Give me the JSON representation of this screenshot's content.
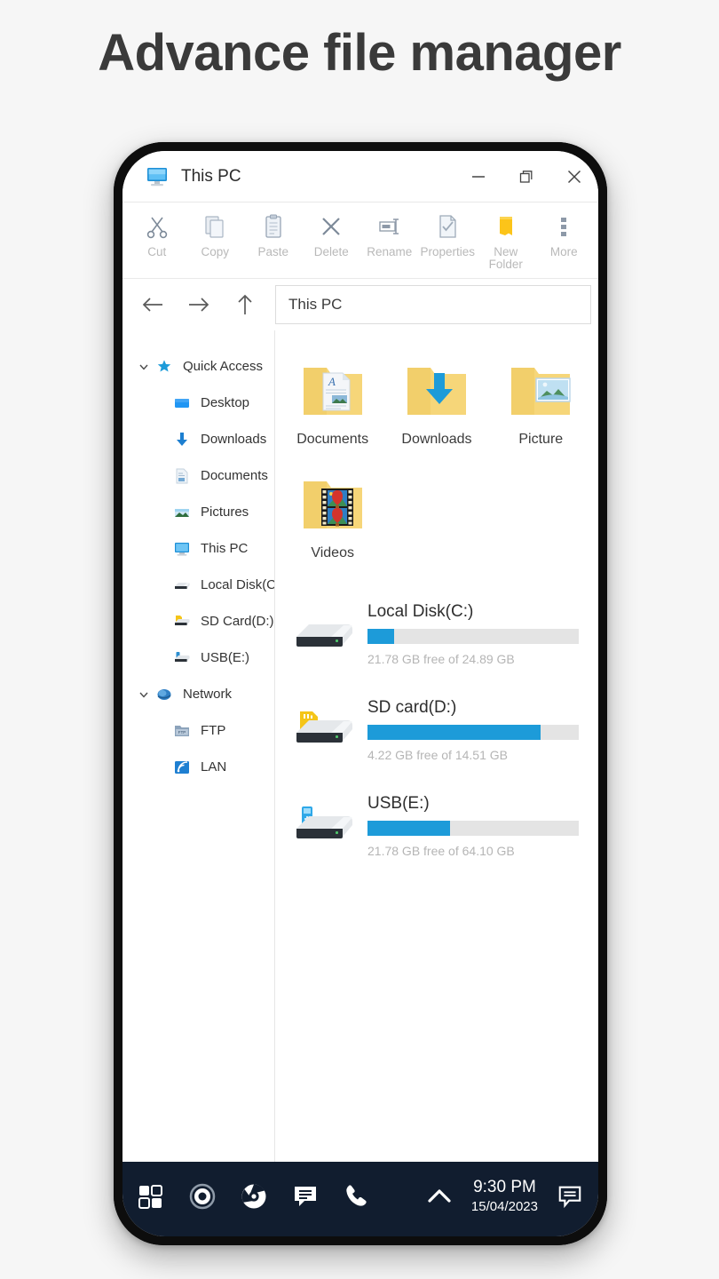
{
  "headline": "Advance file manager",
  "window": {
    "title": "This PC",
    "icon": "monitor-icon",
    "buttons": {
      "minimize": "minimize-icon",
      "maximize": "restore-icon",
      "close": "close-icon"
    }
  },
  "ribbon": {
    "items": [
      {
        "label": "Cut",
        "icon": "scissors-icon"
      },
      {
        "label": "Copy",
        "icon": "copy-icon"
      },
      {
        "label": "Paste",
        "icon": "clipboard-icon"
      },
      {
        "label": "Delete",
        "icon": "x-icon"
      },
      {
        "label": "Rename",
        "icon": "rename-icon"
      },
      {
        "label": "Properties",
        "icon": "properties-icon"
      },
      {
        "label": "New\nFolder",
        "icon": "new-folder-icon"
      },
      {
        "label": "More",
        "icon": "more-vertical-icon"
      }
    ]
  },
  "nav": {
    "back": "arrow-left-icon",
    "forward": "arrow-right-icon",
    "up": "arrow-up-icon",
    "address": "This PC"
  },
  "sidebar": {
    "items": [
      {
        "label": "Quick Access",
        "icon": "star-icon",
        "expandable": true,
        "child": false
      },
      {
        "label": "Desktop",
        "icon": "desktop-icon",
        "expandable": false,
        "child": true
      },
      {
        "label": "Downloads",
        "icon": "download-arrow-icon",
        "expandable": false,
        "child": true
      },
      {
        "label": "Documents",
        "icon": "document-icon",
        "expandable": false,
        "child": true
      },
      {
        "label": "Pictures",
        "icon": "picture-icon",
        "expandable": false,
        "child": true
      },
      {
        "label": "This PC",
        "icon": "monitor-icon",
        "expandable": false,
        "child": true
      },
      {
        "label": "Local Disk(C:)",
        "icon": "drive-icon",
        "expandable": false,
        "child": true
      },
      {
        "label": "SD Card(D:)",
        "icon": "sdcard-drive-icon",
        "expandable": false,
        "child": true
      },
      {
        "label": "USB(E:)",
        "icon": "usb-drive-icon",
        "expandable": false,
        "child": true
      },
      {
        "label": "Network",
        "icon": "network-globe-icon",
        "expandable": true,
        "child": false
      },
      {
        "label": "FTP",
        "icon": "ftp-folder-icon",
        "expandable": false,
        "child": true
      },
      {
        "label": "LAN",
        "icon": "wifi-icon",
        "expandable": false,
        "child": true
      }
    ]
  },
  "content": {
    "folders": [
      {
        "label": "Documents",
        "icon": "folder-documents-icon"
      },
      {
        "label": "Downloads",
        "icon": "folder-downloads-icon"
      },
      {
        "label": "Picture",
        "icon": "folder-pictures-icon"
      },
      {
        "label": "Videos",
        "icon": "folder-videos-icon"
      }
    ],
    "drives": [
      {
        "name": "Local Disk(C:)",
        "icon": "hdd-icon",
        "used_percent": 12.5,
        "free": "21.78 GB",
        "total": "24.89 GB",
        "subtitle": "21.78 GB free of 24.89 GB"
      },
      {
        "name": "SD card(D:)",
        "icon": "sdcard-drive-icon",
        "used_percent": 82,
        "free": "4.22 GB",
        "total": "14.51 GB",
        "subtitle": "4.22 GB free of 14.51 GB"
      },
      {
        "name": "USB(E:)",
        "icon": "usb-drive-icon",
        "used_percent": 39,
        "free": "21.78 GB",
        "total": "64.10 GB",
        "subtitle": "21.78 GB free of 64.10 GB"
      }
    ]
  },
  "taskbar": {
    "left_icons": [
      "start-tiles-icon",
      "circle-assistant-icon",
      "chrome-icon",
      "messages-icon",
      "phone-icon"
    ],
    "chevron": "chevron-up-icon",
    "time": "9:30 PM",
    "date": "15/04/2023",
    "notification_icon": "notification-messages-icon"
  },
  "colors": {
    "accent_blue": "#1d9bd9",
    "folder_yellow": "#f7d268",
    "taskbar_bg": "#111d2f",
    "page_bg": "#f6f6f6",
    "headline_text": "#3a3a3a",
    "muted_text": "#b5b5b5"
  }
}
